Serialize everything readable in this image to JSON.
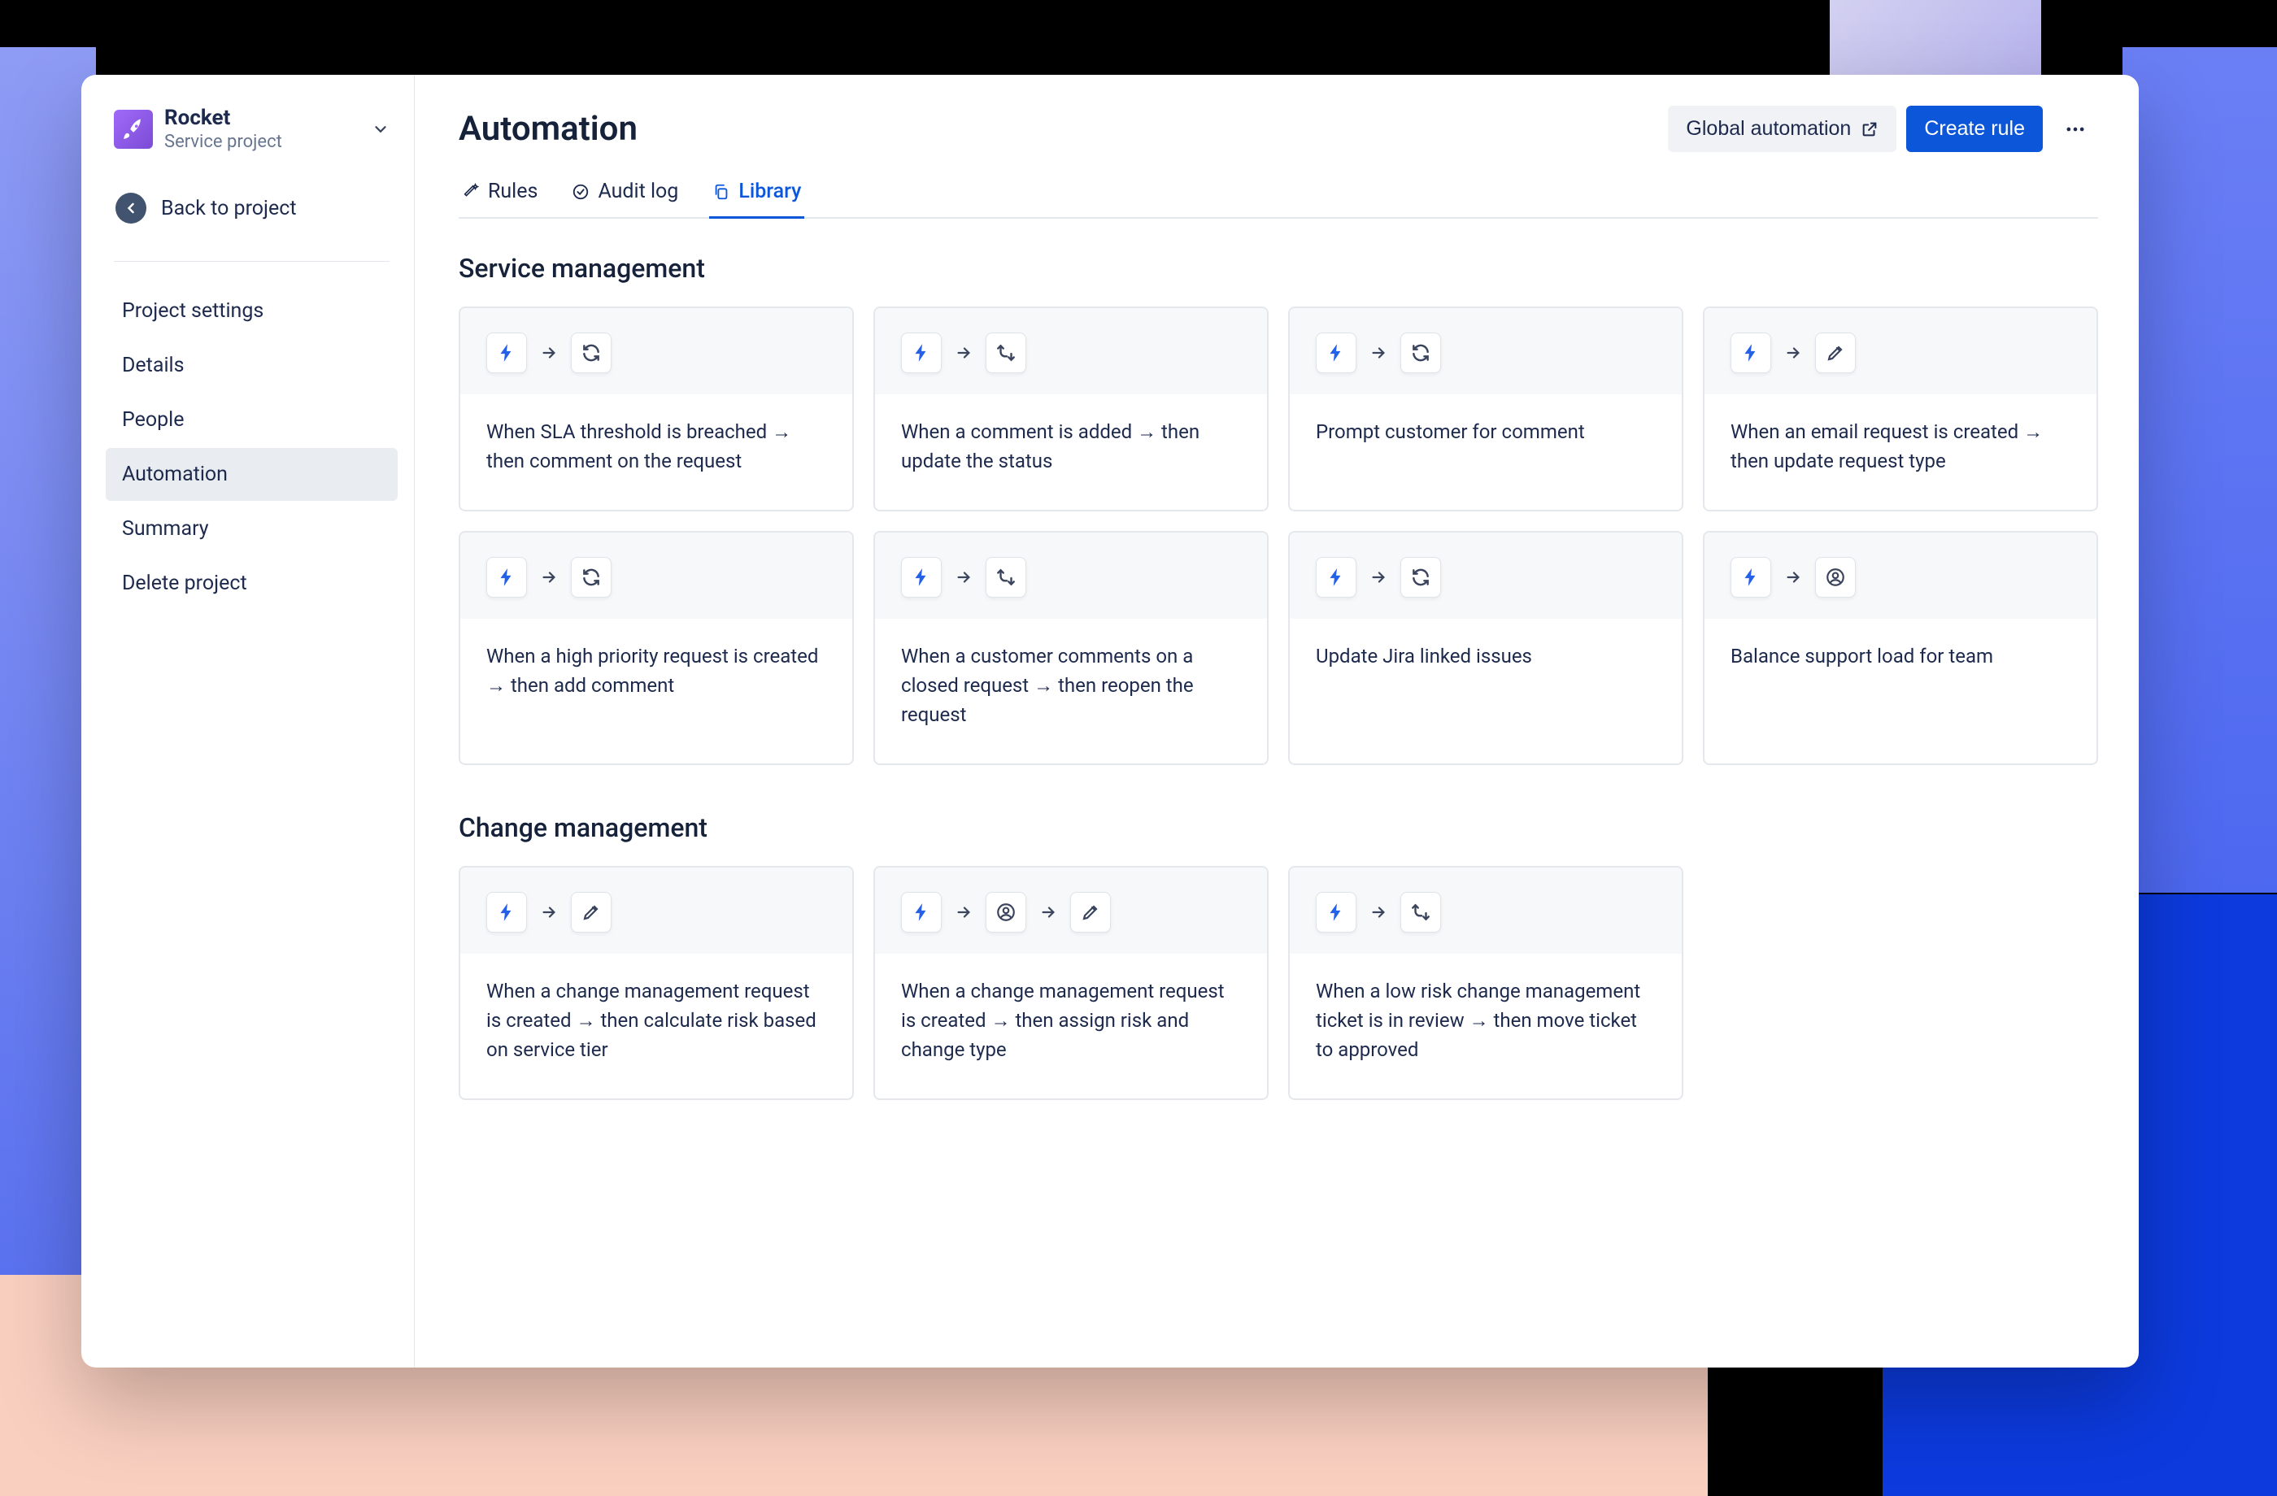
{
  "sidebar": {
    "project_name": "Rocket",
    "project_type": "Service project",
    "back_label": "Back to project",
    "nav": [
      {
        "label": "Project settings",
        "active": false
      },
      {
        "label": "Details",
        "active": false
      },
      {
        "label": "People",
        "active": false
      },
      {
        "label": "Automation",
        "active": true
      },
      {
        "label": "Summary",
        "active": false
      },
      {
        "label": "Delete project",
        "active": false
      }
    ]
  },
  "header": {
    "title": "Automation",
    "global_label": "Global automation",
    "create_label": "Create rule"
  },
  "tabs": [
    {
      "label": "Rules",
      "icon": "wand",
      "active": false
    },
    {
      "label": "Audit log",
      "icon": "check-circle",
      "active": false
    },
    {
      "label": "Library",
      "icon": "copy",
      "active": true
    }
  ],
  "sections": [
    {
      "title": "Service management",
      "cards": [
        {
          "icons": [
            "bolt",
            "refresh"
          ],
          "desc": "When SLA threshold is breached → then comment on the request"
        },
        {
          "icons": [
            "bolt",
            "branch"
          ],
          "desc": "When a comment is added → then update the status"
        },
        {
          "icons": [
            "bolt",
            "refresh"
          ],
          "desc": "Prompt customer for comment"
        },
        {
          "icons": [
            "bolt",
            "pencil"
          ],
          "desc": "When an email request is created → then update request type"
        },
        {
          "icons": [
            "bolt",
            "refresh"
          ],
          "desc": "When a high priority request is created → then add comment"
        },
        {
          "icons": [
            "bolt",
            "branch"
          ],
          "desc": "When a customer comments on a closed request → then reopen the request"
        },
        {
          "icons": [
            "bolt",
            "refresh"
          ],
          "desc": "Update Jira linked issues"
        },
        {
          "icons": [
            "bolt",
            "person"
          ],
          "desc": "Balance support load for team"
        }
      ]
    },
    {
      "title": "Change management",
      "cards": [
        {
          "icons": [
            "bolt",
            "pencil"
          ],
          "desc": "When a change management request is created → then calculate risk based on service tier"
        },
        {
          "icons": [
            "bolt",
            "person",
            "pencil"
          ],
          "desc": "When a change management request is created → then assign risk and change type"
        },
        {
          "icons": [
            "bolt",
            "branch"
          ],
          "desc": "When a low risk change management ticket is in review → then move ticket to approved"
        }
      ]
    }
  ],
  "colors": {
    "primary": "#0b56d9",
    "bolt": "#2560e8",
    "text": "#1d2a4d"
  }
}
